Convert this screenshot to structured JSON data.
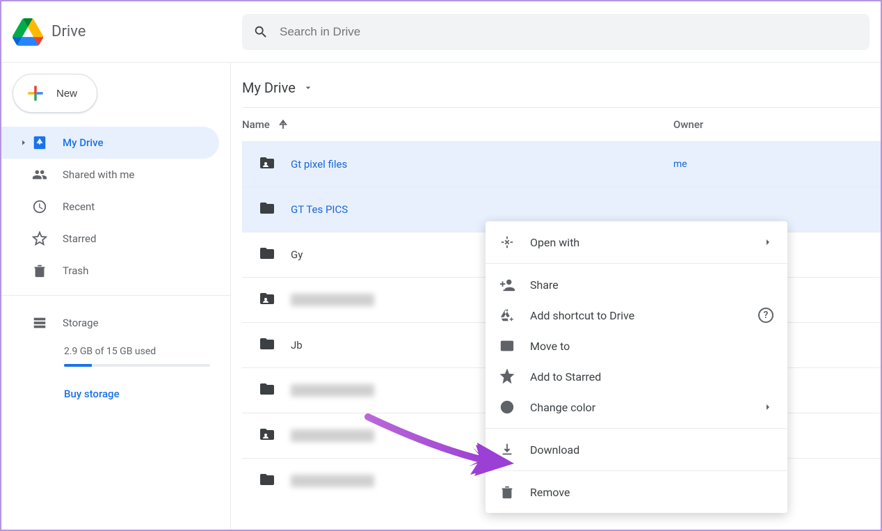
{
  "header": {
    "logo_text": "Drive",
    "search_placeholder": "Search in Drive"
  },
  "new_button": {
    "label": "New"
  },
  "sidebar": {
    "items": [
      {
        "label": "My Drive",
        "icon": "drive-icon",
        "active": true,
        "chev": true
      },
      {
        "label": "Shared with me",
        "icon": "people-icon",
        "active": false,
        "chev": false
      },
      {
        "label": "Recent",
        "icon": "clock-icon",
        "active": false,
        "chev": false
      },
      {
        "label": "Starred",
        "icon": "star-icon",
        "active": false,
        "chev": false
      },
      {
        "label": "Trash",
        "icon": "trash-icon",
        "active": false,
        "chev": false
      }
    ],
    "storage_label": "Storage",
    "storage_text": "2.9 GB of 15 GB used",
    "buy_storage": "Buy storage"
  },
  "breadcrumb": "My Drive",
  "columns": {
    "name": "Name",
    "owner": "Owner"
  },
  "files": [
    {
      "name": "Gt pixel files",
      "owner": "me",
      "selected": true,
      "type": "shared-folder",
      "color": "#5f6368"
    },
    {
      "name": "GT Tes PICS",
      "owner": "",
      "selected": true,
      "type": "folder",
      "color": "#a1c643"
    },
    {
      "name": "Gy",
      "owner": "",
      "selected": false,
      "type": "folder",
      "color": "#5f6368"
    },
    {
      "name": "",
      "owner": "",
      "selected": false,
      "type": "shared-folder",
      "color": "#5f6368",
      "blurred": true
    },
    {
      "name": "Jb",
      "owner": "",
      "selected": false,
      "type": "folder",
      "color": "#5f6368"
    },
    {
      "name": "",
      "owner": "",
      "selected": false,
      "type": "folder",
      "color": "#5f6368",
      "blurred": true
    },
    {
      "name": "",
      "owner": "",
      "selected": false,
      "type": "shared-folder",
      "color": "#5f6368",
      "blurred": true
    },
    {
      "name": "",
      "owner": "",
      "selected": false,
      "type": "folder",
      "color": "#1a73e8",
      "blurred": true
    }
  ],
  "context_menu": {
    "open_with": "Open with",
    "share": "Share",
    "add_shortcut": "Add shortcut to Drive",
    "move_to": "Move to",
    "add_starred": "Add to Starred",
    "change_color": "Change color",
    "download": "Download",
    "remove": "Remove"
  }
}
